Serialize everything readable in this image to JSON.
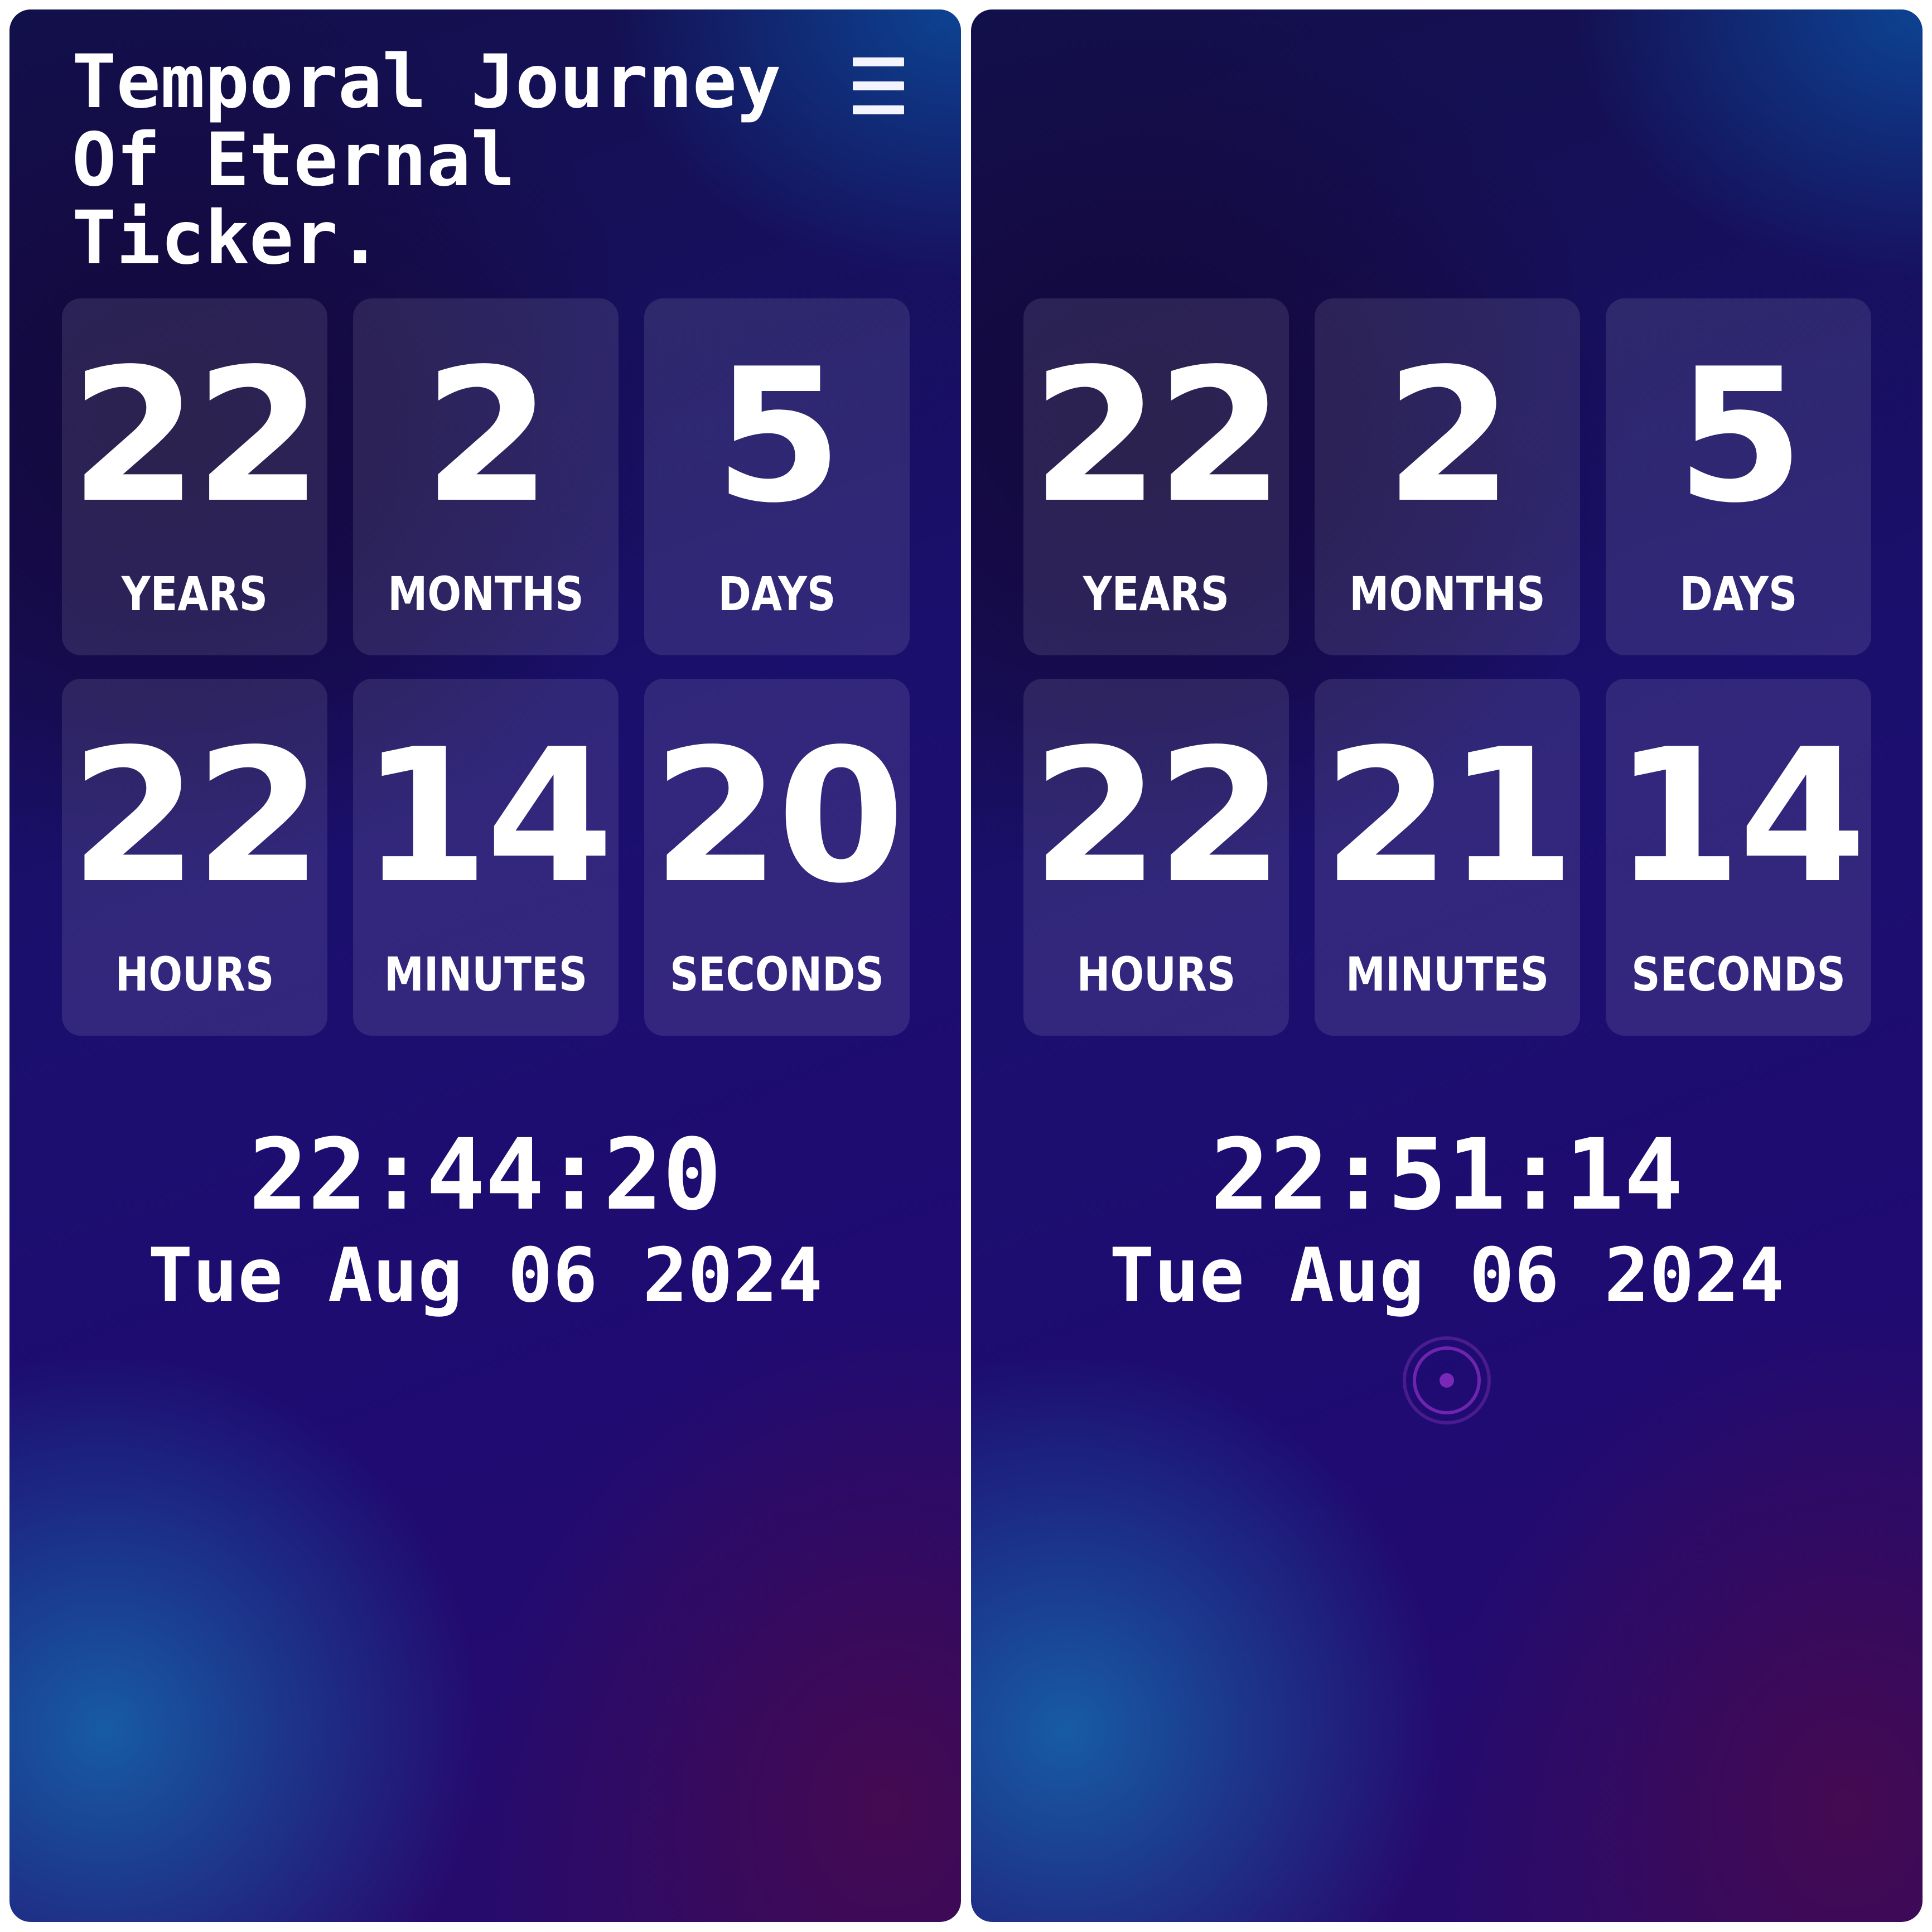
{
  "colors": {
    "text": "#ffffff",
    "tile_background": "rgba(255,255,255,0.10)",
    "gradient_dark": "#14083a",
    "gradient_blue": "#1664aa",
    "gradient_indigo": "#1f0b72",
    "gradient_purple": "#460a50",
    "target_icon": "#7a2ab8"
  },
  "left_panel": {
    "title_line1": "Temporal Journey",
    "title_line2": "Of Eternal Ticker.",
    "menu_icon": "hamburger-menu-icon",
    "counters": [
      {
        "value": "22",
        "unit": "YEARS"
      },
      {
        "value": "2",
        "unit": "MONTHS"
      },
      {
        "value": "5",
        "unit": "DAYS"
      },
      {
        "value": "22",
        "unit": "HOURS"
      },
      {
        "value": "14",
        "unit": "MINUTES"
      },
      {
        "value": "20",
        "unit": "SECONDS"
      }
    ],
    "clock_time": "22:44:20",
    "clock_date": "Tue Aug 06 2024"
  },
  "right_panel": {
    "counters": [
      {
        "value": "22",
        "unit": "YEARS"
      },
      {
        "value": "2",
        "unit": "MONTHS"
      },
      {
        "value": "5",
        "unit": "DAYS"
      },
      {
        "value": "22",
        "unit": "HOURS"
      },
      {
        "value": "21",
        "unit": "MINUTES"
      },
      {
        "value": "14",
        "unit": "SECONDS"
      }
    ],
    "clock_time": "22:51:14",
    "clock_date": "Tue Aug 06 2024",
    "indicator_icon": "target-icon"
  }
}
